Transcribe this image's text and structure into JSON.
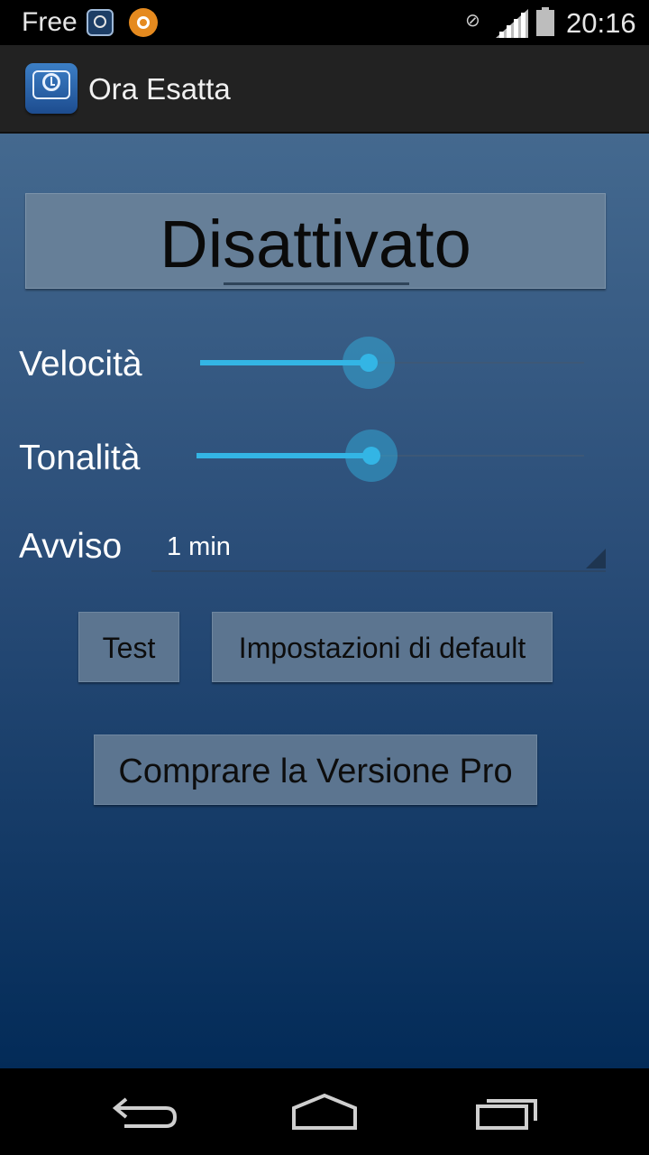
{
  "status_bar": {
    "carrier": "Free",
    "time": "20:16",
    "icons": [
      "ora-esatta-notification-icon",
      "orange-circle-app-icon",
      "mute-icon",
      "signal-icon",
      "battery-icon"
    ]
  },
  "action_bar": {
    "title": "Ora Esatta",
    "icon": "clock-speech-bubble-icon"
  },
  "main": {
    "toggle_label": "Disattivato",
    "speed": {
      "label": "Velocità",
      "value_fraction": 0.44
    },
    "pitch": {
      "label": "Tonalità",
      "value_fraction": 0.45
    },
    "alert": {
      "label": "Avviso",
      "selected": "1 min"
    },
    "buttons": {
      "test": "Test",
      "defaults": "Impostazioni di default",
      "buy_pro": "Comprare la Versione Pro"
    }
  },
  "nav_bar": {
    "icons": [
      "back-icon",
      "home-icon",
      "recent-apps-icon"
    ]
  },
  "colors": {
    "accent": "#33b5e5",
    "button": "#5c7590",
    "toggle_button": "#667f98",
    "background_top": "#44698f",
    "background_bottom": "#032b58",
    "action_bar": "#222222"
  }
}
